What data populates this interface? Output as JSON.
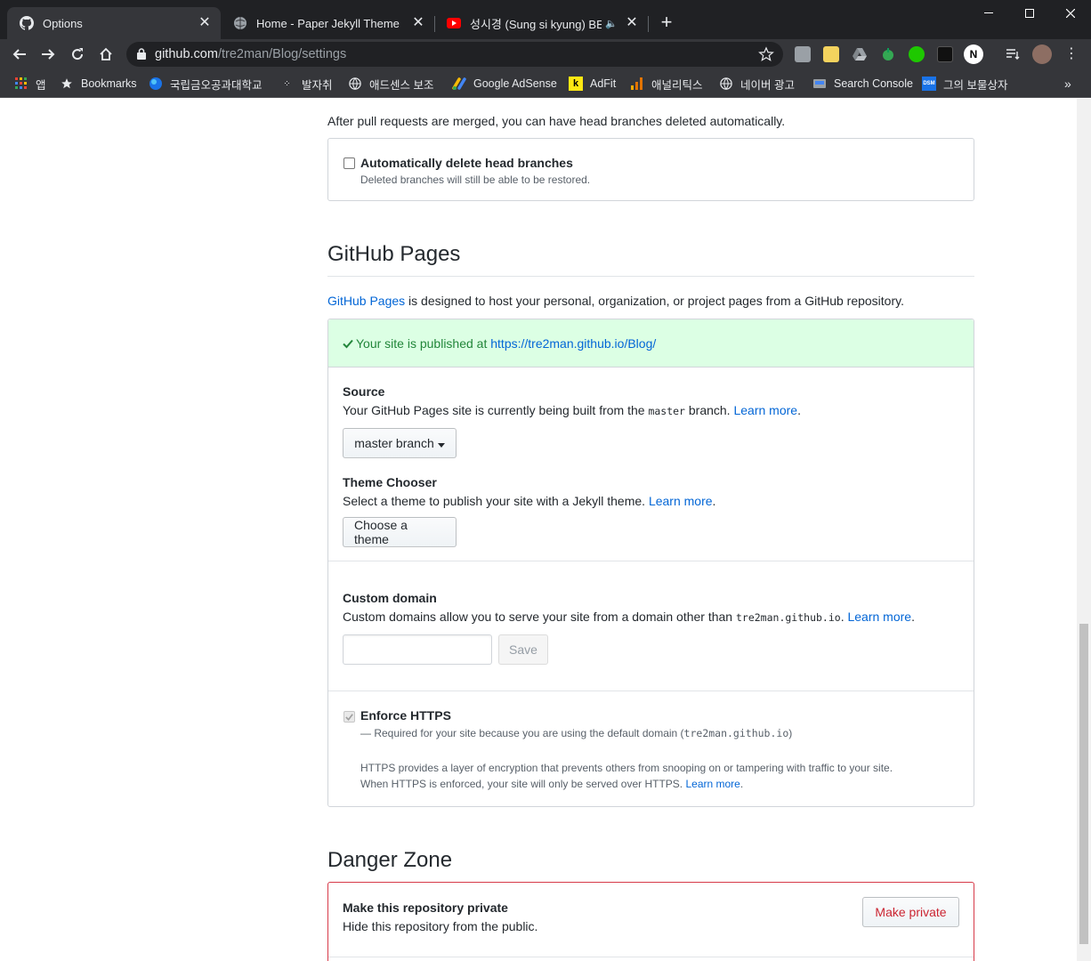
{
  "browser": {
    "tabs": [
      {
        "title": "Options",
        "favicon": "github-icon"
      },
      {
        "title": "Home - Paper Jekyll Theme",
        "favicon": "globe-icon"
      },
      {
        "title": "성시경 (Sung si kyung) BEST",
        "favicon": "youtube-icon",
        "audio": true
      }
    ],
    "url_host": "github.com",
    "url_path": "/tre2man/Blog/settings",
    "bookmarks": [
      {
        "label": "앱",
        "icon": "apps-grid-icon"
      },
      {
        "label": "Bookmarks",
        "icon": "star-icon"
      },
      {
        "label": "국립금오공과대학교",
        "icon": "globe-blue-icon"
      },
      {
        "label": "발자취",
        "icon": "dots-icon"
      },
      {
        "label": "애드센스 보조",
        "icon": "globe-icon"
      },
      {
        "label": "Google AdSense",
        "icon": "adsense-icon"
      },
      {
        "label": "AdFit",
        "icon": "kakao-k-icon"
      },
      {
        "label": "애널리틱스",
        "icon": "analytics-icon"
      },
      {
        "label": "네이버 광고",
        "icon": "globe-icon"
      },
      {
        "label": "Search Console",
        "icon": "search-console-icon"
      },
      {
        "label": "그의 보물상자",
        "icon": "dsm-icon"
      }
    ],
    "profile_badge": "N"
  },
  "colors": {
    "link": "#0366d6",
    "success_bg": "#dcffe4",
    "success_text": "#22863a",
    "danger": "#cb2431"
  },
  "page": {
    "delete_branches": {
      "intro": "After pull requests are merged, you can have head branches deleted automatically.",
      "checkbox_label": "Automatically delete head branches",
      "checkbox_note": "Deleted branches will still be able to be restored.",
      "checked": false
    },
    "pages": {
      "heading": "GitHub Pages",
      "intro_link": "GitHub Pages",
      "intro_rest": " is designed to host your personal, organization, or project pages from a GitHub repository.",
      "published_prefix": "Your site is published at ",
      "published_url": "https://tre2man.github.io/Blog/",
      "source": {
        "title": "Source",
        "desc_before": "Your GitHub Pages site is currently being built from the ",
        "branch_code": "master",
        "desc_after": " branch. ",
        "learn_more": "Learn more",
        "period": ".",
        "button": "master branch"
      },
      "theme": {
        "title": "Theme Chooser",
        "desc": "Select a theme to publish your site with a Jekyll theme. ",
        "learn_more": "Learn more",
        "period": ".",
        "button": "Choose a theme"
      },
      "custom_domain": {
        "title": "Custom domain",
        "desc_before": "Custom domains allow you to serve your site from a domain other than ",
        "domain_code": "tre2man.github.io",
        "desc_after": ". ",
        "learn_more": "Learn more",
        "period": ".",
        "input_value": "",
        "save": "Save"
      },
      "https": {
        "title": "Enforce HTTPS",
        "note_before": "— Required for your site because you are using the default domain (",
        "note_code": "tre2man.github.io",
        "note_after": ")",
        "para1": "HTTPS provides a layer of encryption that prevents others from snooping on or tampering with traffic to your site.",
        "para2": "When HTTPS is enforced, your site will only be served over HTTPS. ",
        "learn_more": "Learn more",
        "period": ".",
        "checked": true
      }
    },
    "danger": {
      "heading": "Danger Zone",
      "private_title": "Make this repository private",
      "private_desc": "Hide this repository from the public.",
      "private_button": "Make private"
    }
  }
}
